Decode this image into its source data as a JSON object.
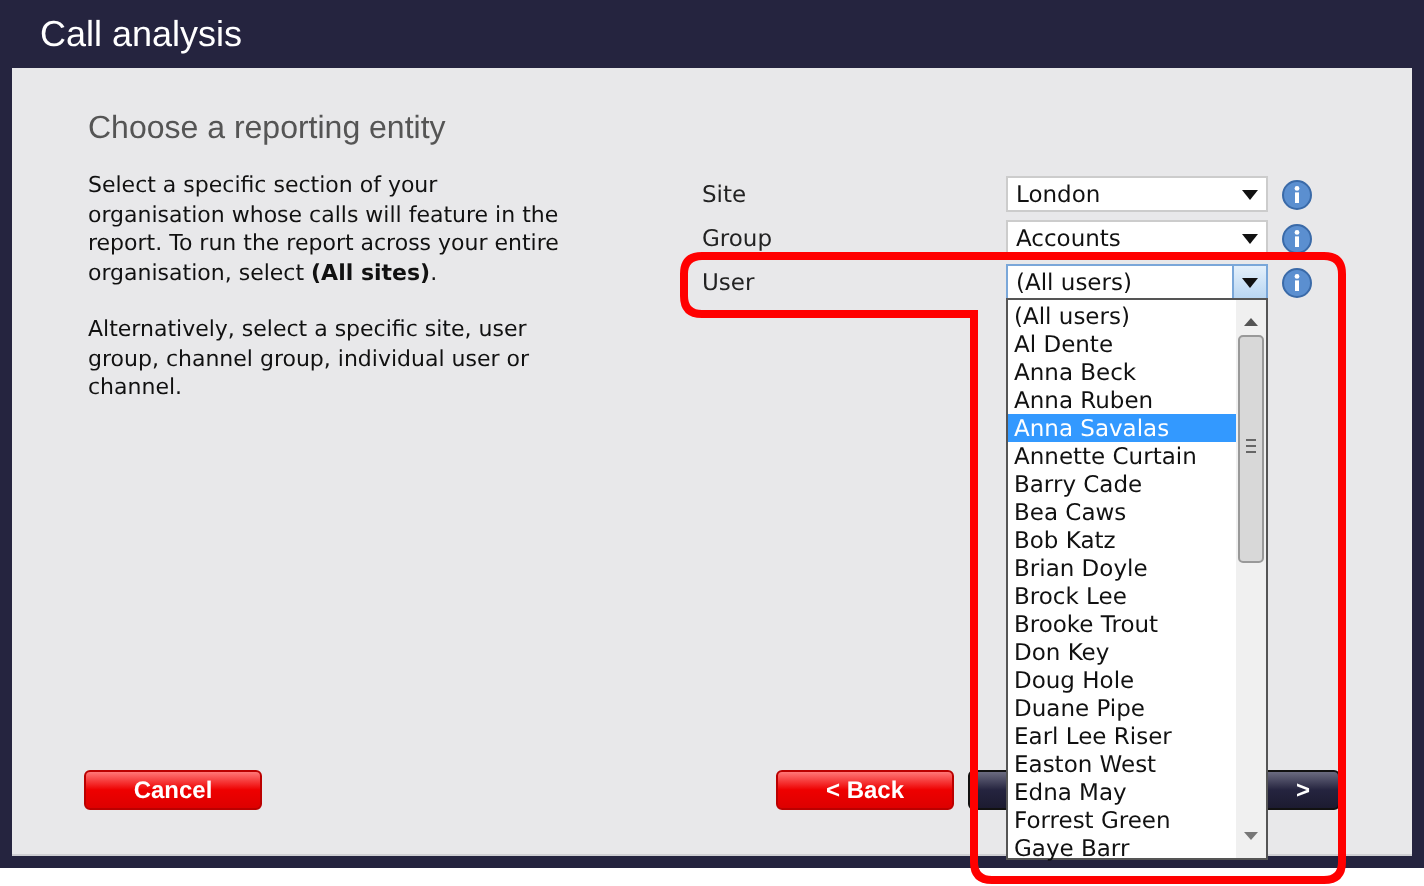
{
  "window": {
    "title": "Call analysis"
  },
  "heading": "Choose a reporting entity",
  "description": [
    "Select a specific section of your organisation whose calls will feature in the report.  To run the report across your entire organisation, select **(All sites)**.",
    "Alternatively, select a specific site, user group, channel group, individual user or channel."
  ],
  "fields": [
    {
      "label": "Site",
      "value": "London",
      "open": false
    },
    {
      "label": "Group",
      "value": "Accounts",
      "open": false
    },
    {
      "label": "User",
      "value": "(All users)",
      "open": true
    }
  ],
  "dropdown_list": {
    "items": [
      {
        "label": "(All users)",
        "selected": false
      },
      {
        "label": "Al Dente",
        "selected": false
      },
      {
        "label": "Anna Beck",
        "selected": false
      },
      {
        "label": "Anna Ruben",
        "selected": false
      },
      {
        "label": "Anna Savalas",
        "selected": true
      },
      {
        "label": "Annette Curtain",
        "selected": false
      },
      {
        "label": "Barry Cade",
        "selected": false
      },
      {
        "label": "Bea Caws",
        "selected": false
      },
      {
        "label": "Bob Katz",
        "selected": false
      },
      {
        "label": "Brian Doyle",
        "selected": false
      },
      {
        "label": "Brock Lee",
        "selected": false
      },
      {
        "label": "Brooke Trout",
        "selected": false
      },
      {
        "label": "Don Key",
        "selected": false
      },
      {
        "label": "Doug Hole",
        "selected": false
      },
      {
        "label": "Duane Pipe",
        "selected": false
      },
      {
        "label": "Earl Lee Riser",
        "selected": false
      },
      {
        "label": "Easton West",
        "selected": false
      },
      {
        "label": "Edna May",
        "selected": false
      },
      {
        "label": "Forrest Green",
        "selected": false
      },
      {
        "label": "Gaye Barr",
        "selected": false
      }
    ]
  },
  "buttons": [
    {
      "label": "Cancel",
      "kind": "red"
    },
    {
      "label": "< Back",
      "kind": "red"
    },
    {
      "label": ">",
      "kind": "dark"
    }
  ]
}
